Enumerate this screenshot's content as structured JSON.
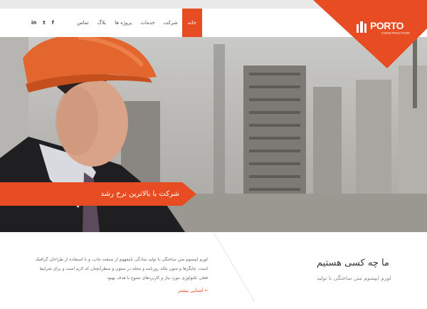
{
  "nav": {
    "items": [
      {
        "label": "خانه",
        "active": true
      },
      {
        "label": "شرکت",
        "active": false
      },
      {
        "label": "خدمات",
        "active": false
      },
      {
        "label": "پروژه ها",
        "active": false
      },
      {
        "label": "بلاگ",
        "active": false
      },
      {
        "label": "تماس",
        "active": false
      }
    ]
  },
  "social": {
    "facebook": "f",
    "twitter": "t",
    "linkedin": "in"
  },
  "logo": {
    "name": "PORTO",
    "sub": "CONSTRUCTION",
    "icon": "building-icon"
  },
  "hero": {
    "ribbon_text": "شرکت با بالاترین نرخ رشد"
  },
  "intro": {
    "title": "ما چه کسی هستیم",
    "subtitle": "لورم ایپسوم متن ساختگی با تولید",
    "paragraph": "لورم ایپسوم متن ساختگی با تولید سادگی نامفهوم از صنعت چاپ، و با استفاده از طراحان گرافیک است. چاپگرها و متون بلکه روزنامه و مجله در ستون و سطرآنچنان که لازم است و برای شرایط فعلی تکنولوژی مورد نیاز و کاربردهای متنوع با هدف بهبود",
    "read_more": "آشنایی بیشتر ←"
  },
  "colors": {
    "accent": "#e84c22",
    "text": "#333333"
  }
}
